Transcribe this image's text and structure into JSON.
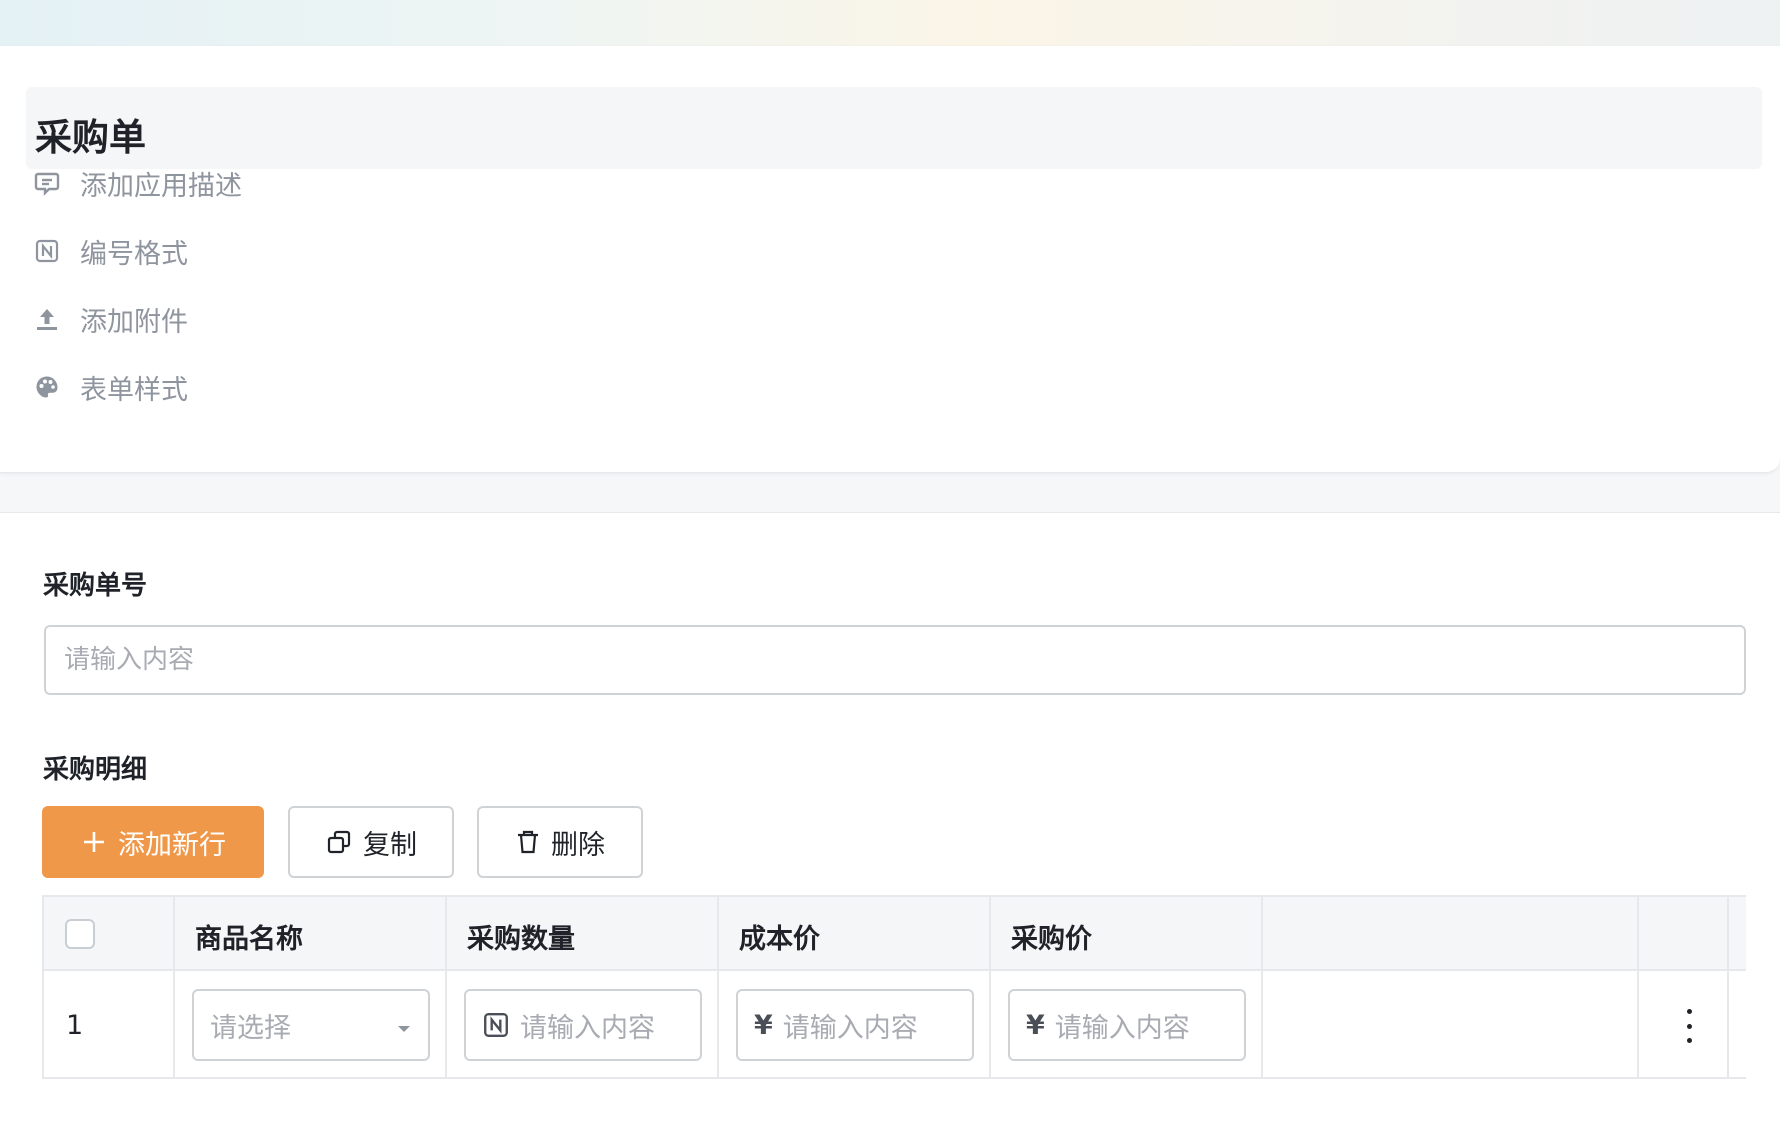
{
  "form": {
    "title": "采购单",
    "options": [
      {
        "label": "添加应用描述",
        "icon": "comment-icon"
      },
      {
        "label": "编号格式",
        "icon": "number-format-icon"
      },
      {
        "label": "添加附件",
        "icon": "upload-icon"
      },
      {
        "label": "表单样式",
        "icon": "palette-icon"
      }
    ]
  },
  "fields": {
    "order_no": {
      "label": "采购单号",
      "placeholder": "请输入内容"
    },
    "details": {
      "label": "采购明细"
    }
  },
  "toolbar": {
    "add_label": "添加新行",
    "copy_label": "复制",
    "delete_label": "删除"
  },
  "table": {
    "columns": [
      "商品名称",
      "采购数量",
      "成本价",
      "采购价"
    ],
    "rows": [
      {
        "index": "1",
        "product_placeholder": "请选择",
        "quantity_placeholder": "请输入内容",
        "cost_prefix": "¥",
        "cost_placeholder": "请输入内容",
        "price_prefix": "¥",
        "price_placeholder": "请输入内容"
      }
    ]
  },
  "colors": {
    "primary": "#f0984a",
    "muted_text": "#8f959e",
    "border": "#d0d3d6"
  }
}
